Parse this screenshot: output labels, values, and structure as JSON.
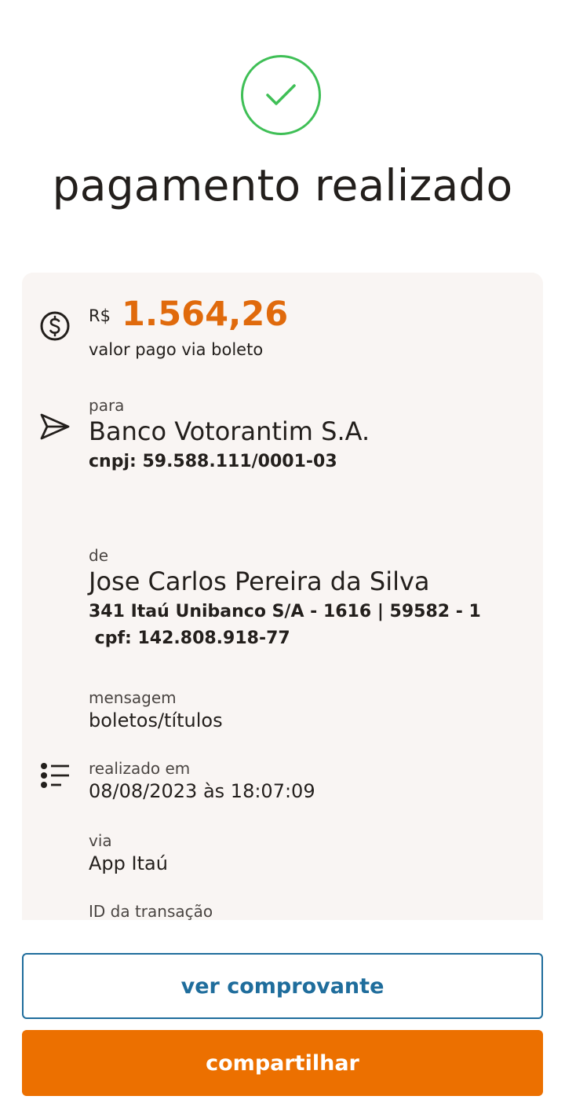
{
  "header": {
    "title": "pagamento realizado",
    "status_icon": "check-circle-icon",
    "accent_color": "#3fbf56"
  },
  "payment": {
    "currency": "R$",
    "amount": "1.564,26",
    "amount_label": "valor pago via boleto",
    "amount_color": "#e06a0c"
  },
  "recipient": {
    "label": "para",
    "name": "Banco Votorantim S.A.",
    "document": "cnpj: 59.588.111/0001-03"
  },
  "payer": {
    "label": "de",
    "name": "Jose Carlos Pereira da Silva",
    "account": "341 Itaú Unibanco S/A - 1616 | 59582 - 1",
    "document": " cpf: 142.808.918-77"
  },
  "details": {
    "message_label": "mensagem",
    "message_value": "boletos/títulos",
    "date_label": "realizado em",
    "date_value": "08/08/2023 às 18:07:09",
    "via_label": "via",
    "via_value": "App Itaú",
    "transaction_label": "ID da transação"
  },
  "actions": {
    "view_receipt": "ver comprovante",
    "share": "compartilhar",
    "primary_color": "#ec7000",
    "secondary_color": "#1f6d9c"
  }
}
